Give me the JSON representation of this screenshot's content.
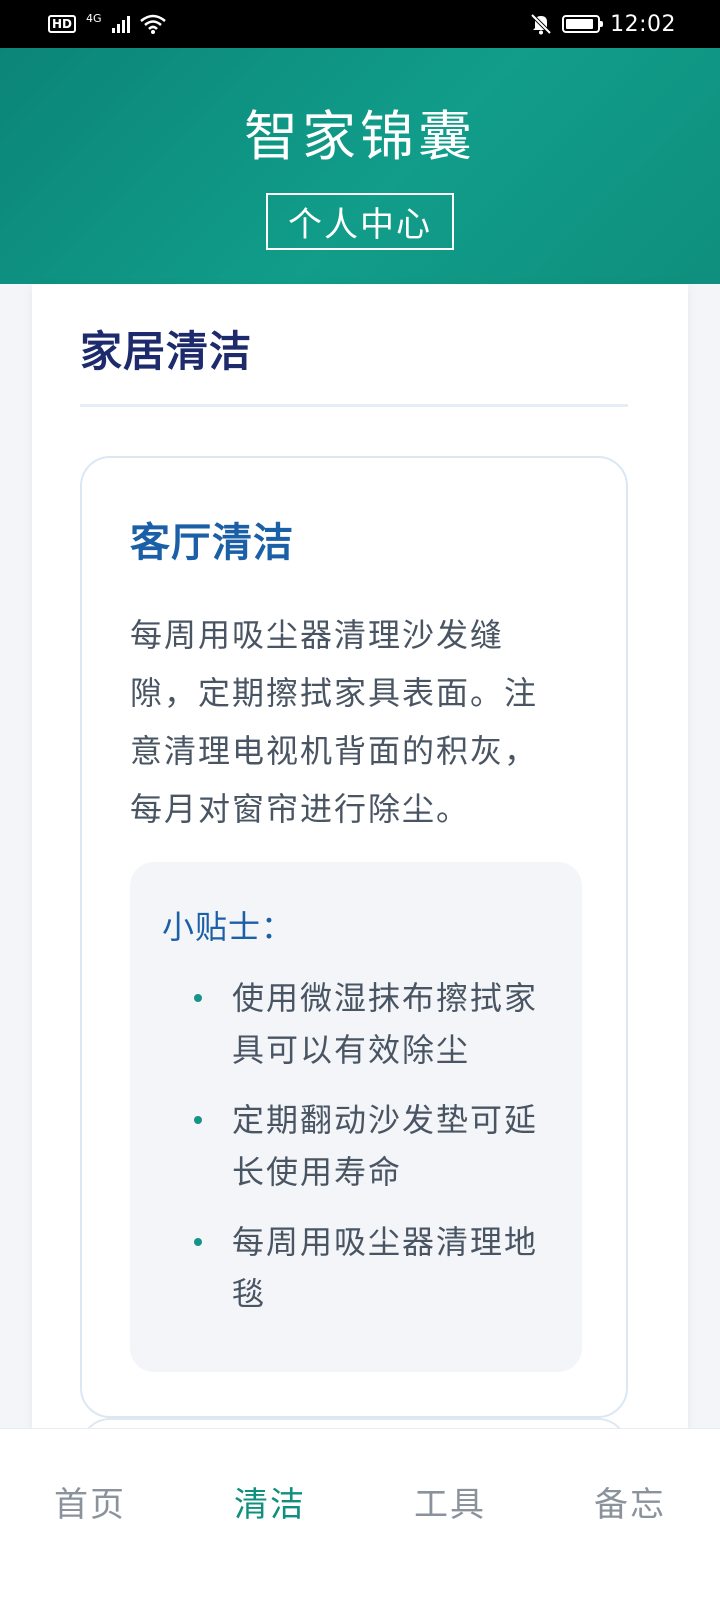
{
  "status_bar": {
    "hd": "HD",
    "network": "4G",
    "time": "12:02",
    "icons": [
      "signal-icon",
      "wifi-icon",
      "bell-mute-icon",
      "battery-icon"
    ],
    "battery_level": 0.9
  },
  "header": {
    "title": "智家锦囊",
    "profile_button": "个人中心",
    "background_colors": [
      "#0b8577",
      "#119d8a"
    ]
  },
  "section": {
    "title": "家居清洁"
  },
  "topic": {
    "title": "客厅清洁",
    "description": "每周用吸尘器清理沙发缝隙，定期擦拭家具表面。注意清理电视机背面的积灰，每月对窗帘进行除尘。",
    "tips_title": "小贴士：",
    "tips": [
      "使用微湿抹布擦拭家具可以有效除尘",
      "定期翻动沙发垫可延长使用寿命",
      "每周用吸尘器清理地毯"
    ]
  },
  "bottom_nav": {
    "items": [
      {
        "label": "首页",
        "active": false
      },
      {
        "label": "清洁",
        "active": true
      },
      {
        "label": "工具",
        "active": false
      },
      {
        "label": "备忘",
        "active": false
      }
    ],
    "active_color": "#0f8f7d"
  }
}
